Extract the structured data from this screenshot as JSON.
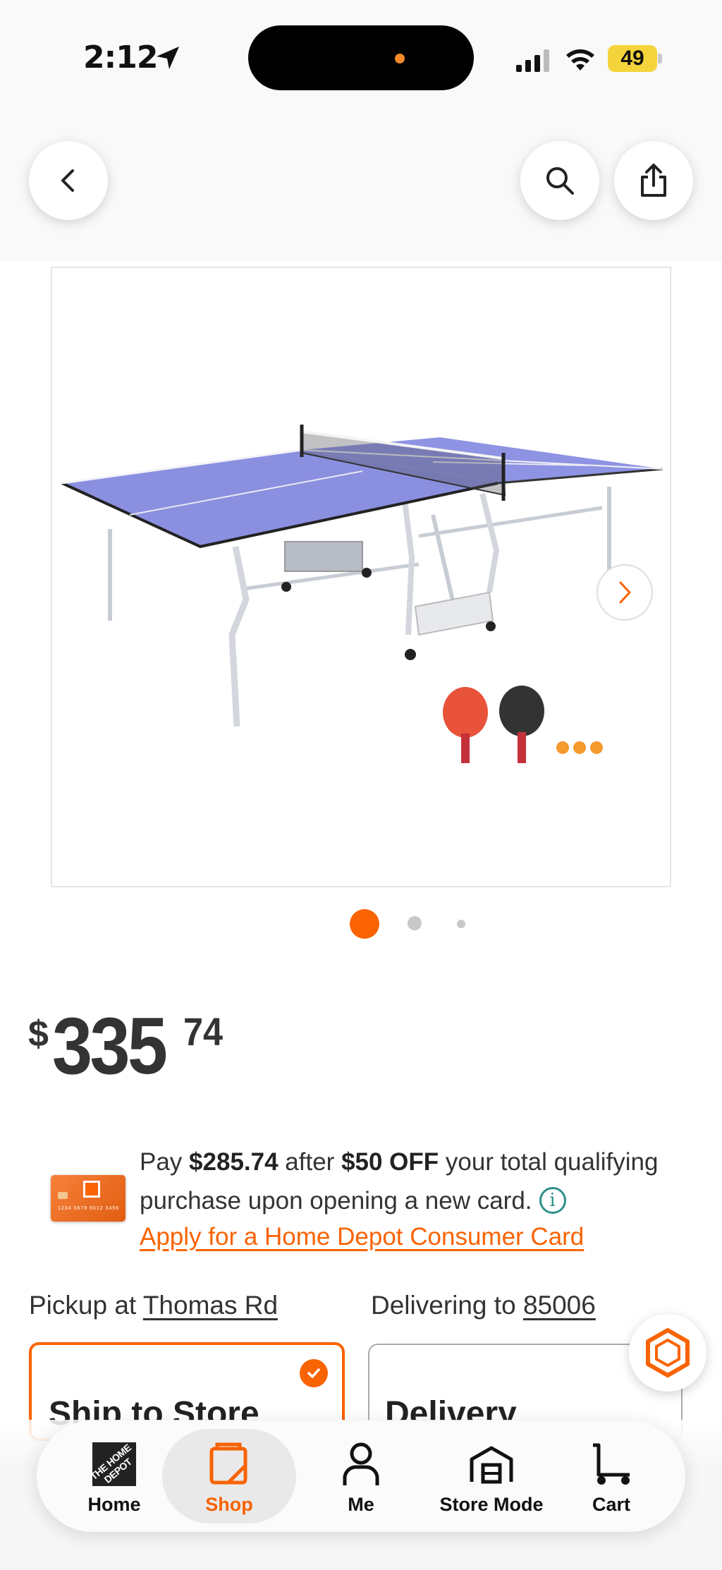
{
  "status_bar": {
    "time": "2:12",
    "battery": "49",
    "accent_color": "#f96302"
  },
  "header": {
    "back_icon": "chevron-left-icon",
    "search_icon": "search-icon",
    "share_icon": "share-icon"
  },
  "product": {
    "image_description_icon": "ping-pong-table-image",
    "carousel": {
      "total": 3,
      "active": 1
    }
  },
  "price": {
    "currency": "$",
    "dollars": "335",
    "cents": "74"
  },
  "promo": {
    "pay_prefix": "Pay ",
    "pay_amount": "$285.74",
    "after": " after ",
    "discount": "$50 OFF",
    "rest": " your total qualifying purchase upon opening a new card.",
    "info_symbol": "i",
    "apply_link": "Apply for a Home Depot Consumer Card",
    "card_number": "1234 5678 9012 3456"
  },
  "fulfillment": {
    "pickup_prefix": "Pickup at ",
    "pickup_store": "Thomas Rd",
    "delivery_prefix": "Delivering to ",
    "delivery_zip": "85006",
    "ship_to_store": "Ship to Store",
    "delivery": "Delivery"
  },
  "tab_bar": {
    "home": "Home",
    "shop": "Shop",
    "me": "Me",
    "store_mode": "Store Mode",
    "cart": "Cart",
    "logo_text": "THE HOME DEPOT",
    "active": "Shop"
  }
}
